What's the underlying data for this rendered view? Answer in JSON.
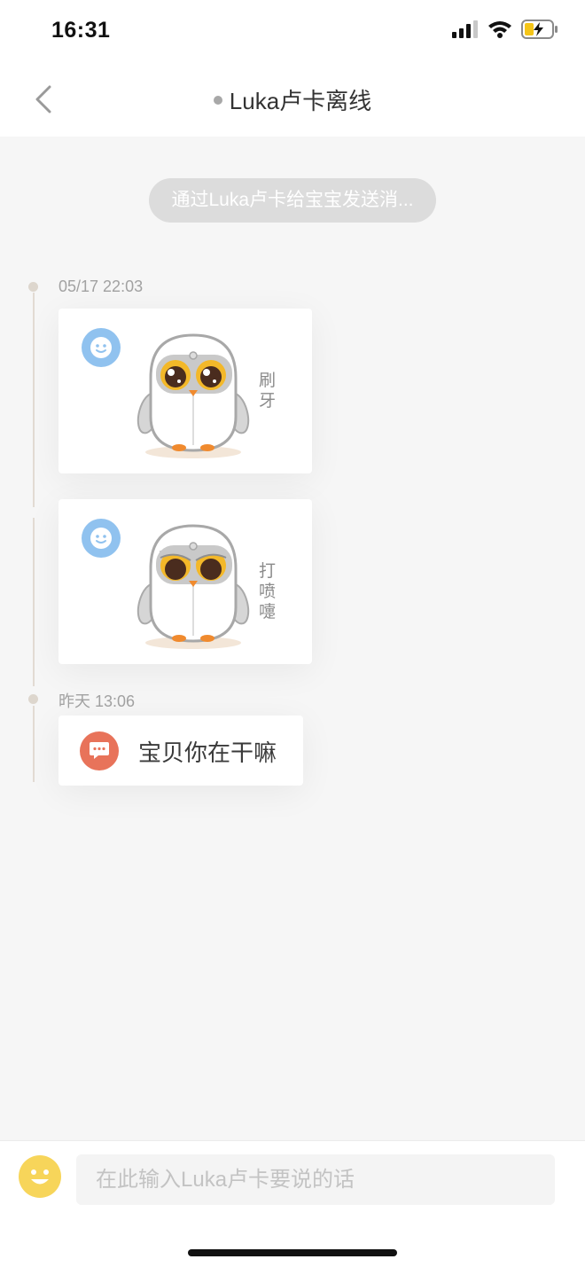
{
  "status_bar": {
    "time": "16:31",
    "signal_icon": "cellular-signal-icon",
    "wifi_icon": "wifi-icon",
    "battery_icon": "battery-charging-icon"
  },
  "nav": {
    "back_icon": "chevron-left-icon",
    "title": "Luka卢卡离线",
    "status_color": "#a8a8a8"
  },
  "hint": {
    "text": "通过Luka卢卡给宝宝发送消..."
  },
  "timeline": [
    {
      "timestamp": "05/17 22:03",
      "items": [
        {
          "type": "expression",
          "avatar_icon": "smiley-face-icon",
          "image": "owl-expression-brushing-teeth",
          "caption": "刷牙"
        },
        {
          "type": "expression",
          "avatar_icon": "smiley-face-icon",
          "image": "owl-expression-sneeze",
          "caption": "打喷嚏"
        }
      ]
    },
    {
      "timestamp": "昨天 13:06",
      "items": [
        {
          "type": "text",
          "icon": "chat-bubble-icon",
          "text": "宝贝你在干嘛"
        }
      ]
    }
  ],
  "input": {
    "emoji_icon": "emoji-icon",
    "placeholder": "在此输入Luka卢卡要说的话"
  },
  "colors": {
    "accent_blue": "#90c2ef",
    "accent_orange": "#e8735a",
    "emoji_yellow": "#f7d55a",
    "owl_eye_yellow": "#f3b829"
  }
}
